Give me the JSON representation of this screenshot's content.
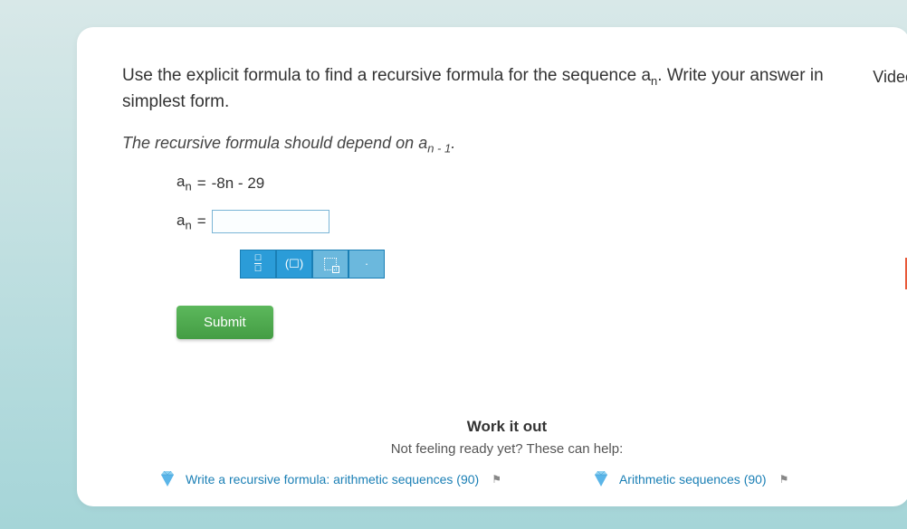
{
  "header": {
    "video_link": "Video"
  },
  "question": {
    "text_part1": "Use the explicit formula to find a recursive formula for the sequence ",
    "seq_var": "a",
    "seq_sub": "n",
    "text_part2": ". Write your answer in simplest form.",
    "instruction_part1": "The recursive formula should depend on ",
    "instruction_var": "a",
    "instruction_sub": "n - 1",
    "instruction_part2": "."
  },
  "formula": {
    "given_lhs_var": "a",
    "given_lhs_sub": "n",
    "given_eq": " = ",
    "given_rhs": "-8n - 29",
    "answer_lhs_var": "a",
    "answer_lhs_sub": "n",
    "answer_eq": " = ",
    "answer_value": ""
  },
  "toolbar": {
    "fraction_label": "fraction",
    "paren_label": "(☐)",
    "sub_label": "subscript",
    "dot_label": "·"
  },
  "actions": {
    "submit": "Submit"
  },
  "footer": {
    "heading": "Work it out",
    "subheading": "Not feeling ready yet? These can help:",
    "links": [
      {
        "label": "Write a recursive formula: arithmetic sequences (90)"
      },
      {
        "label": "Arithmetic sequences (90)"
      }
    ]
  }
}
